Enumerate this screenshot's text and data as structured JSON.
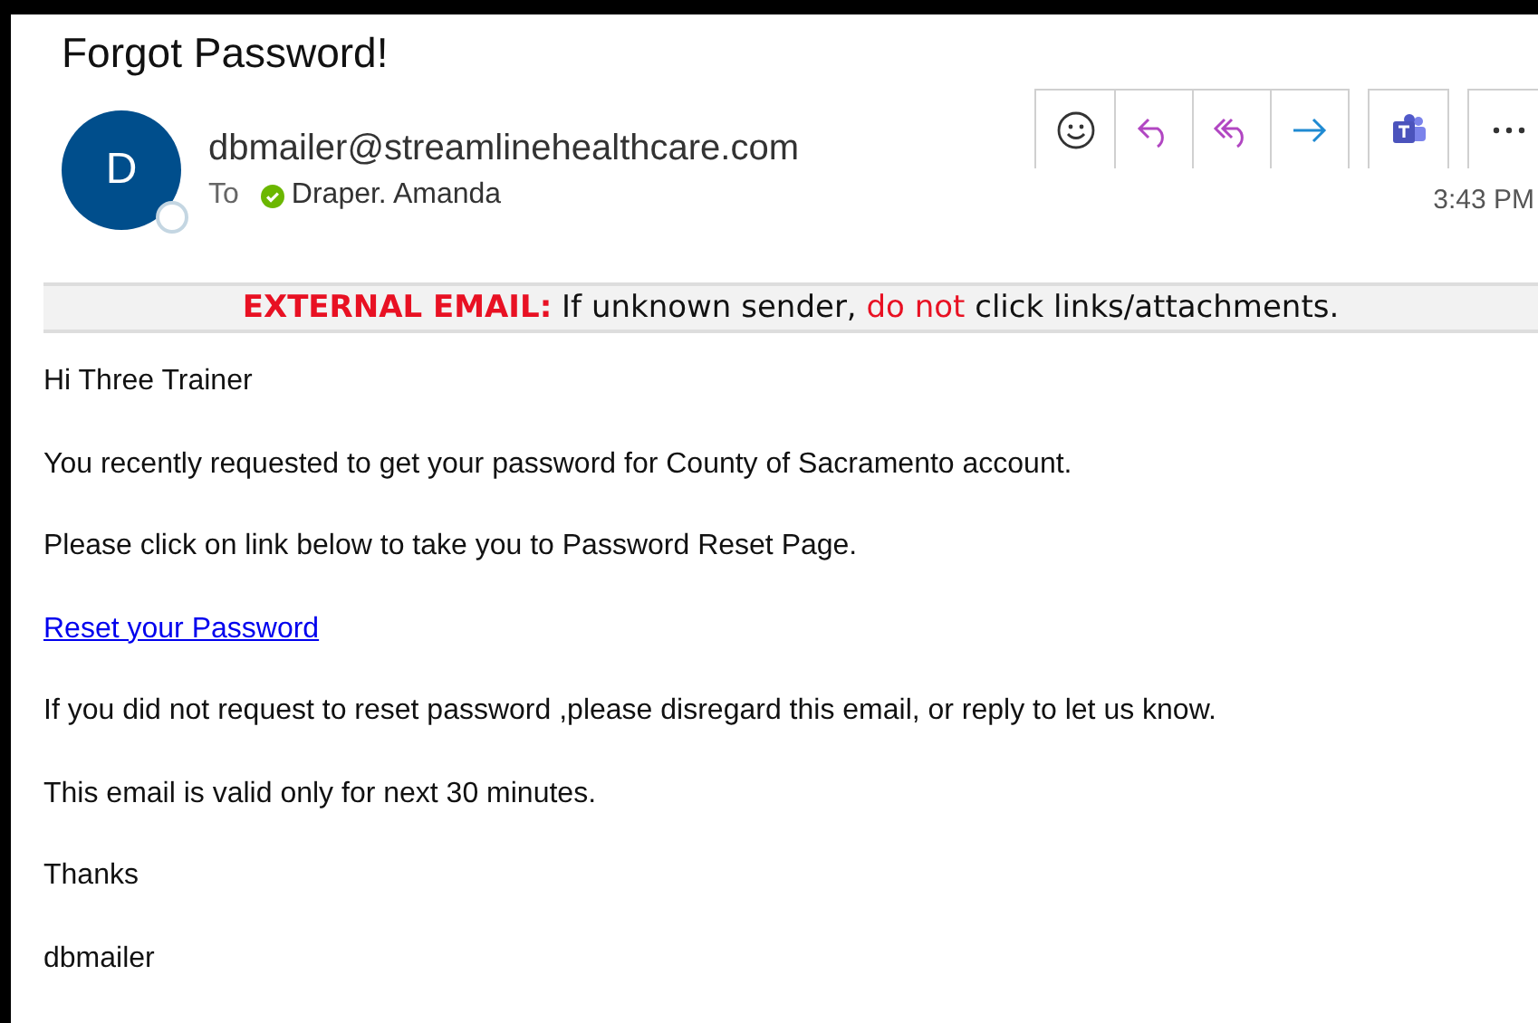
{
  "subject": "Forgot Password!",
  "sender": {
    "initial": "D",
    "address": "dbmailer@streamlinehealthcare.com",
    "to_label": "To",
    "recipient": "Draper. Amanda",
    "recipient_available": true,
    "time": "3:43 PM"
  },
  "toolbar": [
    {
      "kind": "emoji"
    },
    {
      "kind": "reply"
    },
    {
      "kind": "reply_all"
    },
    {
      "kind": "forward"
    },
    {
      "kind": "teams"
    },
    {
      "kind": "more"
    }
  ],
  "banner": [
    {
      "kind": "label",
      "text": "EXTERNAL EMAIL:"
    },
    {
      "kind": "plain",
      "text": " If unknown sender, "
    },
    {
      "kind": "warn",
      "text": "do not"
    },
    {
      "kind": "plain",
      "text": " click links/attachments."
    }
  ],
  "body": [
    {
      "kind": "text",
      "text": "Hi Three Trainer"
    },
    {
      "kind": "text",
      "text": "You recently requested to get your password for County of Sacramento account."
    },
    {
      "kind": "text",
      "text": "Please click on link below to take you to Password Reset Page."
    },
    {
      "kind": "link",
      "text": "Reset your Password"
    },
    {
      "kind": "text",
      "text": "If you did not request to reset password ,please disregard this email, or reply to let us know."
    },
    {
      "kind": "text",
      "text": "This email is valid only for next 30 minutes."
    },
    {
      "kind": "text",
      "text": "Thanks"
    },
    {
      "kind": "text",
      "text": "dbmailer"
    }
  ]
}
